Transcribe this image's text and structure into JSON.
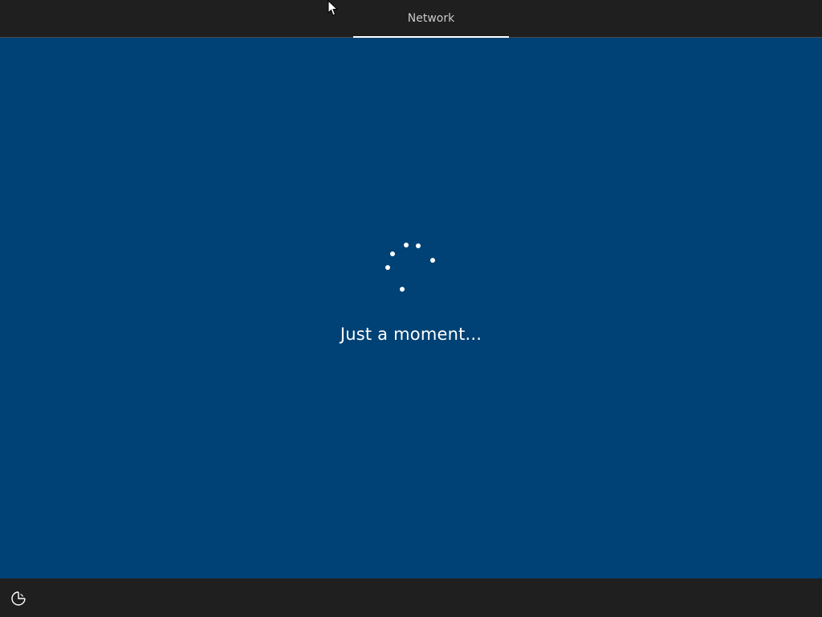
{
  "header": {
    "tab_label": "Network"
  },
  "main": {
    "status_text": "Just a moment..."
  },
  "footer": {
    "ease_of_access_icon": "ease-of-access-icon"
  },
  "colors": {
    "background": "#004275",
    "bars": "#1f1f1f",
    "text": "#ffffff",
    "tab_text": "#c9c9c9"
  }
}
